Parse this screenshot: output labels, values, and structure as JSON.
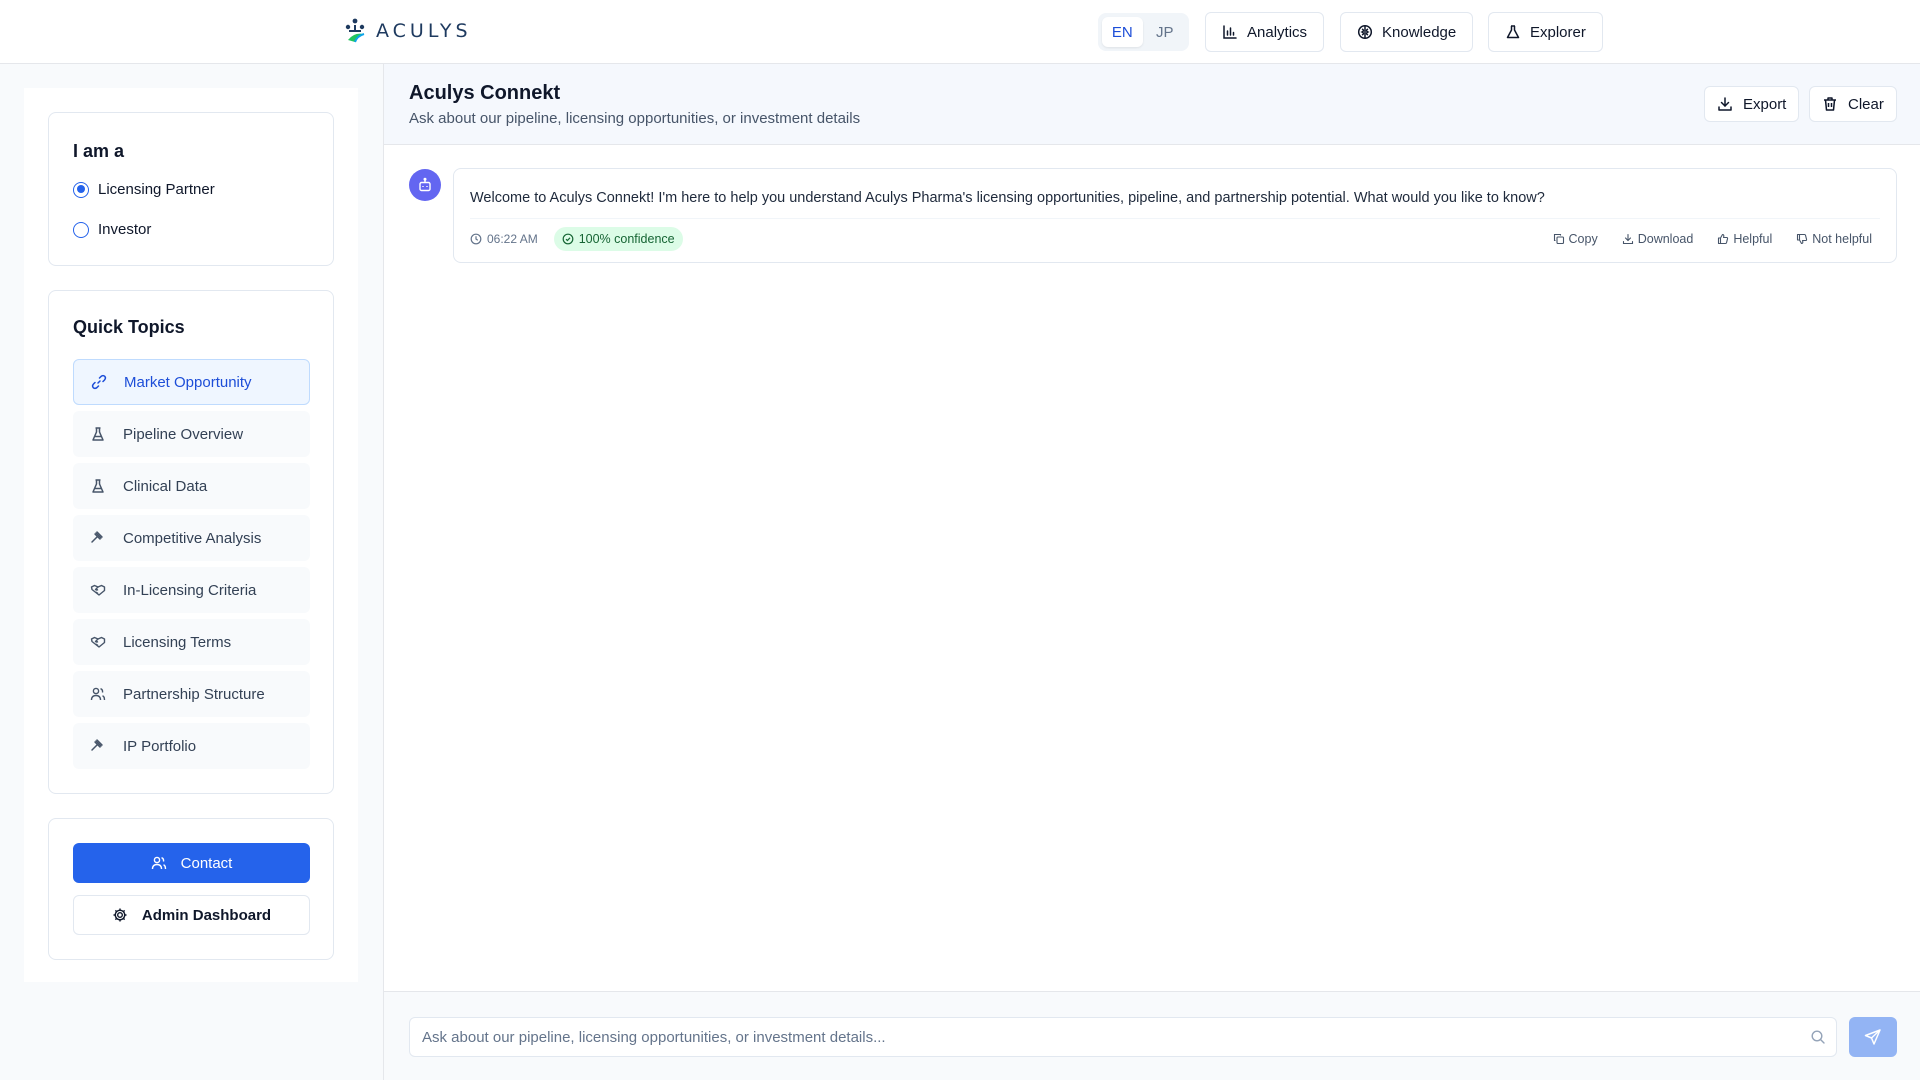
{
  "header": {
    "logo_text": "ACULYS",
    "languages": [
      {
        "label": "EN",
        "active": true
      },
      {
        "label": "JP",
        "active": false
      }
    ],
    "nav": [
      {
        "label": "Analytics",
        "icon": "bar-chart-icon"
      },
      {
        "label": "Knowledge",
        "icon": "brain-icon"
      },
      {
        "label": "Explorer",
        "icon": "flask-icon"
      }
    ]
  },
  "sidebar": {
    "role": {
      "title": "I am a",
      "options": [
        {
          "label": "Licensing Partner",
          "selected": true
        },
        {
          "label": "Investor",
          "selected": false
        }
      ]
    },
    "quick_topics": {
      "title": "Quick Topics",
      "items": [
        {
          "label": "Market Opportunity",
          "icon": "link-icon",
          "active": true
        },
        {
          "label": "Pipeline Overview",
          "icon": "flask-icon",
          "active": false
        },
        {
          "label": "Clinical Data",
          "icon": "flask-icon",
          "active": false
        },
        {
          "label": "Competitive Analysis",
          "icon": "gavel-icon",
          "active": false
        },
        {
          "label": "In-Licensing Criteria",
          "icon": "handshake-icon",
          "active": false
        },
        {
          "label": "Licensing Terms",
          "icon": "handshake-icon",
          "active": false
        },
        {
          "label": "Partnership Structure",
          "icon": "users-icon",
          "active": false
        },
        {
          "label": "IP Portfolio",
          "icon": "gavel-icon",
          "active": false
        }
      ]
    },
    "actions": {
      "contact_label": "Contact",
      "admin_label": "Admin Dashboard"
    }
  },
  "chat": {
    "title": "Aculys Connekt",
    "subtitle": "Ask about our pipeline, licensing opportunities, or investment details",
    "export_label": "Export",
    "clear_label": "Clear",
    "messages": [
      {
        "text": "Welcome to Aculys Connekt! I'm here to help you understand Aculys Pharma's licensing opportunities, pipeline, and partnership potential. What would you like to know?",
        "time": "06:22 AM",
        "confidence": "100% confidence",
        "actions": {
          "copy": "Copy",
          "download": "Download",
          "helpful": "Helpful",
          "not_helpful": "Not helpful"
        }
      }
    ],
    "input": {
      "placeholder": "Ask about our pipeline, licensing opportunities, or investment details...",
      "value": ""
    }
  },
  "colors": {
    "primary": "#2563eb",
    "avatar": "#6366f1",
    "confidence_bg": "#dcfce7",
    "confidence_fg": "#166534"
  }
}
